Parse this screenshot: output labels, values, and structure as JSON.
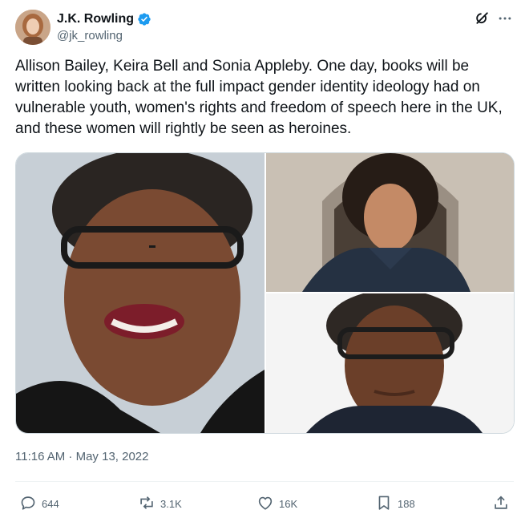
{
  "author": {
    "display_name": "J.K. Rowling",
    "handle": "@jk_rowling",
    "verified": true,
    "verified_color": "#1d9bf0"
  },
  "tweet": {
    "text": "Allison Bailey, Keira Bell and Sonia Appleby. One day, books will be written looking back at the full impact gender identity ideology had on vulnerable youth, women's rights and freedom of speech here in the UK, and these women will rightly be seen as heroines.",
    "timestamp": "11:16 AM · May 13, 2022"
  },
  "media": {
    "photo_count": 3,
    "icons": [
      "portrait-photo",
      "portrait-photo",
      "portrait-photo"
    ]
  },
  "actions": {
    "replies": "644",
    "reposts": "3.1K",
    "likes": "16K",
    "bookmarks": "188"
  },
  "icons": {
    "header": [
      "grok-icon",
      "more-icon"
    ],
    "actions": [
      "reply-icon",
      "repost-icon",
      "like-icon",
      "bookmark-icon",
      "share-icon"
    ]
  }
}
